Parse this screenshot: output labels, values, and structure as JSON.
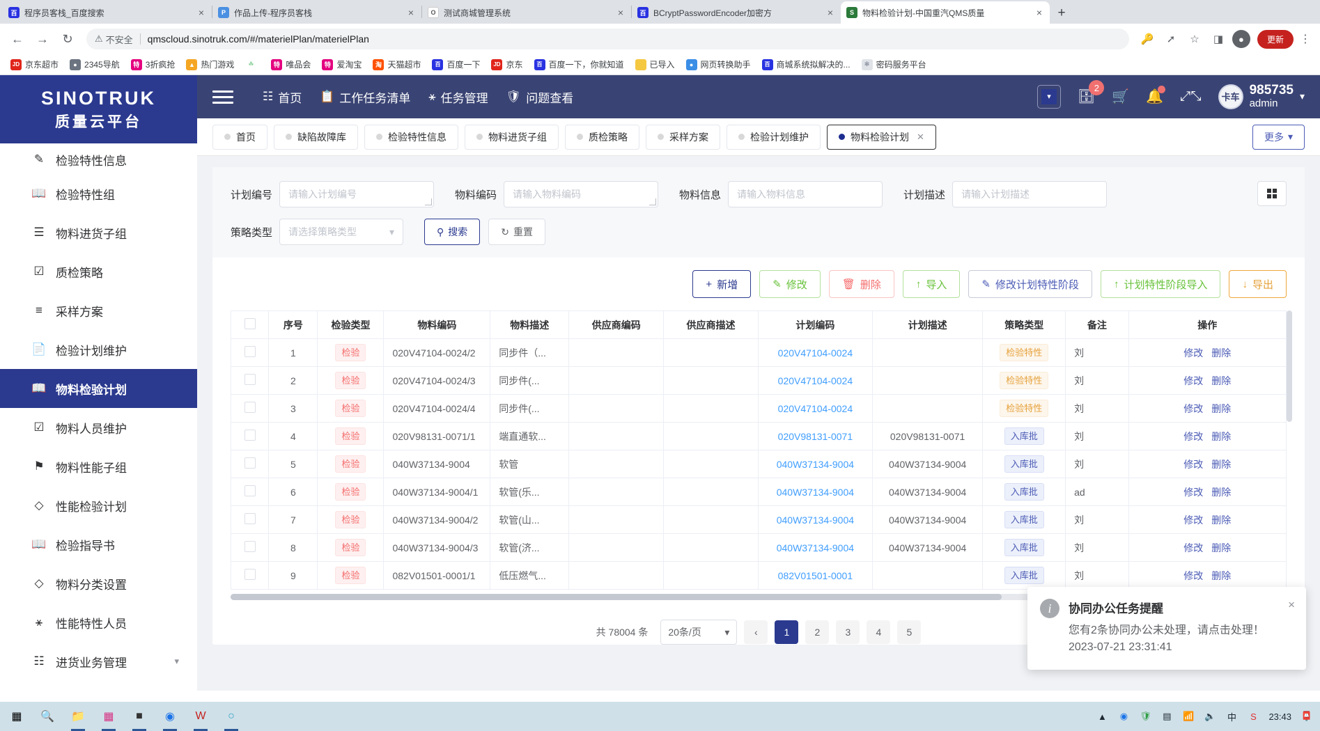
{
  "browser": {
    "tabs": [
      {
        "title": "程序员客栈_百度搜索",
        "favicon": "B",
        "color": "#2932e1",
        "active": false
      },
      {
        "title": "作品上传-程序员客栈",
        "favicon": "P",
        "color": "#4a90e2",
        "active": false
      },
      {
        "title": "测试商城管理系统",
        "favicon": "O",
        "color": "#ffffff",
        "active": false
      },
      {
        "title": "BCryptPasswordEncoder加密方",
        "favicon": "B",
        "color": "#2932e1",
        "active": false
      },
      {
        "title": "物料检验计划-中国重汽QMS质量",
        "favicon": "S",
        "color": "#2b3a8f",
        "active": true
      }
    ],
    "new_tab_label": "+",
    "close_label": "×",
    "toolbar": {
      "back": "←",
      "forward": "→",
      "reload": "↻",
      "security_label": "不安全",
      "security_icon": "⚠",
      "url": "qmscloud.sinotruk.com/#/materielPlan/materielPlan",
      "update_label": "更新",
      "profile_initial": "●"
    },
    "bookmarks": [
      {
        "label": "京东超市",
        "ico": "JD",
        "color": "#e1251b"
      },
      {
        "label": "2345导航",
        "ico": "2",
        "color": "#4a4a4a"
      },
      {
        "label": "3折疯抢",
        "ico": "唯",
        "color": "#e4007f"
      },
      {
        "label": "热门游戏",
        "ico": "▲",
        "color": "#f5a623"
      },
      {
        "label": "",
        "ico": "☘",
        "color": "#8ed19b"
      },
      {
        "label": "唯品会",
        "ico": "唯",
        "color": "#e4007f"
      },
      {
        "label": "爱淘宝",
        "ico": "特",
        "color": "#e4007f"
      },
      {
        "label": "天猫超市",
        "ico": "淘",
        "color": "#ff5000"
      },
      {
        "label": "百度一下",
        "ico": "百",
        "color": "#2932e1"
      },
      {
        "label": "京东",
        "ico": "JD",
        "color": "#e1251b"
      },
      {
        "label": "百度一下，你就知道",
        "ico": "百",
        "color": "#2932e1"
      },
      {
        "label": "已导入",
        "ico": "■",
        "color": "#f5c842"
      },
      {
        "label": "网页转换助手",
        "ico": "◐",
        "color": "#3a8ee6"
      },
      {
        "label": "商城系统拟解决的...",
        "ico": "百",
        "color": "#2932e1"
      },
      {
        "label": "密码服务平台",
        "ico": "✱",
        "color": "#8a8f99"
      }
    ]
  },
  "sidebar": {
    "logo_line1": "SINOTRUK",
    "logo_line2": "质量云平台",
    "items": [
      {
        "label": "检验特性信息",
        "icon": "edit-doc-icon",
        "active": false
      },
      {
        "label": "检验特性组",
        "icon": "book-icon",
        "active": false
      },
      {
        "label": "物料进货子组",
        "icon": "list-icon",
        "active": false
      },
      {
        "label": "质检策略",
        "icon": "shield-check-icon",
        "active": false
      },
      {
        "label": "采样方案",
        "icon": "sample-icon",
        "active": false
      },
      {
        "label": "检验计划维护",
        "icon": "file-icon",
        "active": false
      },
      {
        "label": "物料检验计划",
        "icon": "book-icon",
        "active": true
      },
      {
        "label": "物料人员维护",
        "icon": "shield-check-icon",
        "active": false
      },
      {
        "label": "物料性能子组",
        "icon": "flag-icon",
        "active": false
      },
      {
        "label": "性能检验计划",
        "icon": "diamond-icon",
        "active": false
      },
      {
        "label": "检验指导书",
        "icon": "book-icon",
        "active": false
      },
      {
        "label": "物料分类设置",
        "icon": "diamond-icon",
        "active": false
      },
      {
        "label": "性能特性人员",
        "icon": "person-icon",
        "active": false
      },
      {
        "label": "进货业务管理",
        "icon": "grid-icon",
        "active": false,
        "expandable": true
      }
    ]
  },
  "topbar": {
    "nav": [
      {
        "label": "首页",
        "icon": "grid-icon"
      },
      {
        "label": "工作任务清单",
        "icon": "clipboard-icon"
      },
      {
        "label": "任务管理",
        "icon": "person-icon"
      },
      {
        "label": "问题查看",
        "icon": "shield-icon"
      }
    ],
    "collapse_icon": "chevron-down-icon",
    "inbox_badge": "2",
    "user_id": "985735",
    "user_role": "admin",
    "avatar_text": "卡车"
  },
  "view_tabs": {
    "items": [
      {
        "label": "首页",
        "active": false,
        "closable": false
      },
      {
        "label": "缺陷故障库",
        "active": false,
        "closable": false
      },
      {
        "label": "检验特性信息",
        "active": false,
        "closable": false
      },
      {
        "label": "物料进货子组",
        "active": false,
        "closable": false
      },
      {
        "label": "质检策略",
        "active": false,
        "closable": false
      },
      {
        "label": "采样方案",
        "active": false,
        "closable": false
      },
      {
        "label": "检验计划维护",
        "active": false,
        "closable": false
      },
      {
        "label": "物料检验计划",
        "active": true,
        "closable": true
      }
    ],
    "more_label": "更多"
  },
  "filters": {
    "fields": [
      {
        "label": "计划编号",
        "placeholder": "请输入计划编号",
        "value": "",
        "resizable": true
      },
      {
        "label": "物料编码",
        "placeholder": "请输入物料编码",
        "value": "",
        "resizable": true
      },
      {
        "label": "物料信息",
        "placeholder": "请输入物料信息",
        "value": "",
        "resizable": false
      },
      {
        "label": "计划描述",
        "placeholder": "请输入计划描述",
        "value": "",
        "resizable": false
      }
    ],
    "select": {
      "label": "策略类型",
      "placeholder": "请选择策略类型",
      "value": ""
    },
    "search_label": "搜索",
    "reset_label": "重置"
  },
  "actions": [
    {
      "label": "新增",
      "icon": "plus-icon",
      "style": "a-blue"
    },
    {
      "label": "修改",
      "icon": "pencil-icon",
      "style": "a-green"
    },
    {
      "label": "删除",
      "icon": "trash-icon",
      "style": "a-red"
    },
    {
      "label": "导入",
      "icon": "upload-icon",
      "style": "a-green"
    },
    {
      "label": "修改计划特性阶段",
      "icon": "pencil-icon",
      "style": "a-grey"
    },
    {
      "label": "计划特性阶段导入",
      "icon": "upload-icon",
      "style": "a-green"
    },
    {
      "label": "导出",
      "icon": "download-icon",
      "style": "a-orange"
    }
  ],
  "table": {
    "headers": [
      "",
      "序号",
      "检验类型",
      "物料编码",
      "物料描述",
      "供应商编码",
      "供应商描述",
      "计划编码",
      "计划描述",
      "策略类型",
      "备注",
      "操作"
    ],
    "row_actions": [
      "修改",
      "删除"
    ],
    "rows": [
      {
        "no": "1",
        "type": "检验",
        "material_code": "020V47104-0024/2",
        "material_desc": "同步件（...",
        "supplier_code": "",
        "supplier_desc": "",
        "plan_code": "020V47104-0024",
        "plan_desc": "",
        "strategy": "检验特性",
        "strategy_style": "tag-orange",
        "remark": "刘"
      },
      {
        "no": "2",
        "type": "检验",
        "material_code": "020V47104-0024/3",
        "material_desc": "同步件(...",
        "supplier_code": "",
        "supplier_desc": "",
        "plan_code": "020V47104-0024",
        "plan_desc": "",
        "strategy": "检验特性",
        "strategy_style": "tag-orange",
        "remark": "刘"
      },
      {
        "no": "3",
        "type": "检验",
        "material_code": "020V47104-0024/4",
        "material_desc": "同步件(...",
        "supplier_code": "",
        "supplier_desc": "",
        "plan_code": "020V47104-0024",
        "plan_desc": "",
        "strategy": "检验特性",
        "strategy_style": "tag-orange",
        "remark": "刘"
      },
      {
        "no": "4",
        "type": "检验",
        "material_code": "020V98131-0071/1",
        "material_desc": "端直通软...",
        "supplier_code": "",
        "supplier_desc": "",
        "plan_code": "020V98131-0071",
        "plan_desc": "020V98131-0071",
        "strategy": "入库批",
        "strategy_style": "tag-blue",
        "remark": "刘"
      },
      {
        "no": "5",
        "type": "检验",
        "material_code": "040W37134-9004",
        "material_desc": "软管",
        "supplier_code": "",
        "supplier_desc": "",
        "plan_code": "040W37134-9004",
        "plan_desc": "040W37134-9004",
        "strategy": "入库批",
        "strategy_style": "tag-blue",
        "remark": "刘"
      },
      {
        "no": "6",
        "type": "检验",
        "material_code": "040W37134-9004/1",
        "material_desc": "软管(乐...",
        "supplier_code": "",
        "supplier_desc": "",
        "plan_code": "040W37134-9004",
        "plan_desc": "040W37134-9004",
        "strategy": "入库批",
        "strategy_style": "tag-blue",
        "remark": "ad"
      },
      {
        "no": "7",
        "type": "检验",
        "material_code": "040W37134-9004/2",
        "material_desc": "软管(山...",
        "supplier_code": "",
        "supplier_desc": "",
        "plan_code": "040W37134-9004",
        "plan_desc": "040W37134-9004",
        "strategy": "入库批",
        "strategy_style": "tag-blue",
        "remark": "刘"
      },
      {
        "no": "8",
        "type": "检验",
        "material_code": "040W37134-9004/3",
        "material_desc": "软管(济...",
        "supplier_code": "",
        "supplier_desc": "",
        "plan_code": "040W37134-9004",
        "plan_desc": "040W37134-9004",
        "strategy": "入库批",
        "strategy_style": "tag-blue",
        "remark": "刘"
      },
      {
        "no": "9",
        "type": "检验",
        "material_code": "082V01501-0001/1",
        "material_desc": "低压燃气...",
        "supplier_code": "",
        "supplier_desc": "",
        "plan_code": "082V01501-0001",
        "plan_desc": "",
        "strategy": "入库批",
        "strategy_style": "tag-blue",
        "remark": "刘"
      }
    ]
  },
  "pagination": {
    "total_label": "共 78004 条",
    "page_size": "20条/页",
    "prev": "‹",
    "pages": [
      "1",
      "2",
      "3",
      "4",
      "5"
    ],
    "current": "1"
  },
  "toast": {
    "title": "协同办公任务提醒",
    "message": "您有2条协同办公未处理，请点击处理！ 2023-07-21 23:31:41",
    "close": "×",
    "icon": "info-icon"
  },
  "taskbar": {
    "left_icons": [
      "windows-icon",
      "search-icon",
      "explorer-icon",
      "store-icon",
      "device-icon",
      "chrome-icon",
      "word-icon",
      "edge-icon"
    ],
    "tray_icons": [
      "chevron-up-icon",
      "chrome-tray-icon",
      "shield-tray-icon",
      "screen-icon",
      "network-icon",
      "volume-icon",
      "ime-icon",
      "sogou-icon"
    ],
    "clock": "23:43",
    "notification_icon": "notification-icon"
  }
}
